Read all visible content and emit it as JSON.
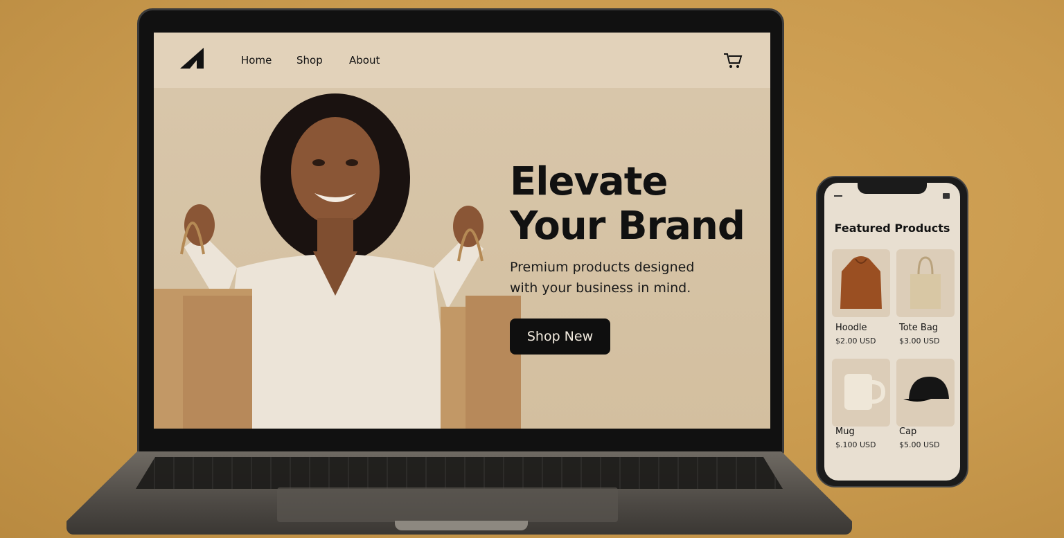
{
  "nav": {
    "links": [
      "Home",
      "Shop",
      "About"
    ]
  },
  "hero": {
    "title_line1": "Elevate",
    "title_line2": "Your Brand",
    "subtitle_line1": "Premium products designed",
    "subtitle_line2": "with your business in mind.",
    "cta_label": "Shop New"
  },
  "phone": {
    "title": "Featured Products",
    "products": [
      {
        "name": "Hoodle",
        "price": "$2.00 USD"
      },
      {
        "name": "Tote Bag",
        "price": "$3.00 USD"
      },
      {
        "name": "Mug",
        "price": "$.100 USD"
      },
      {
        "name": "Cap",
        "price": "$5.00 USD"
      }
    ]
  },
  "icons": {
    "logo": "logo-icon",
    "cart": "cart-icon",
    "menu": "menu-icon"
  },
  "colors": {
    "accent": "#0f0f0f",
    "hero_background": "#d6c3a6",
    "nav_background": "#e2d2ba",
    "page_background": "#c99a4e"
  }
}
